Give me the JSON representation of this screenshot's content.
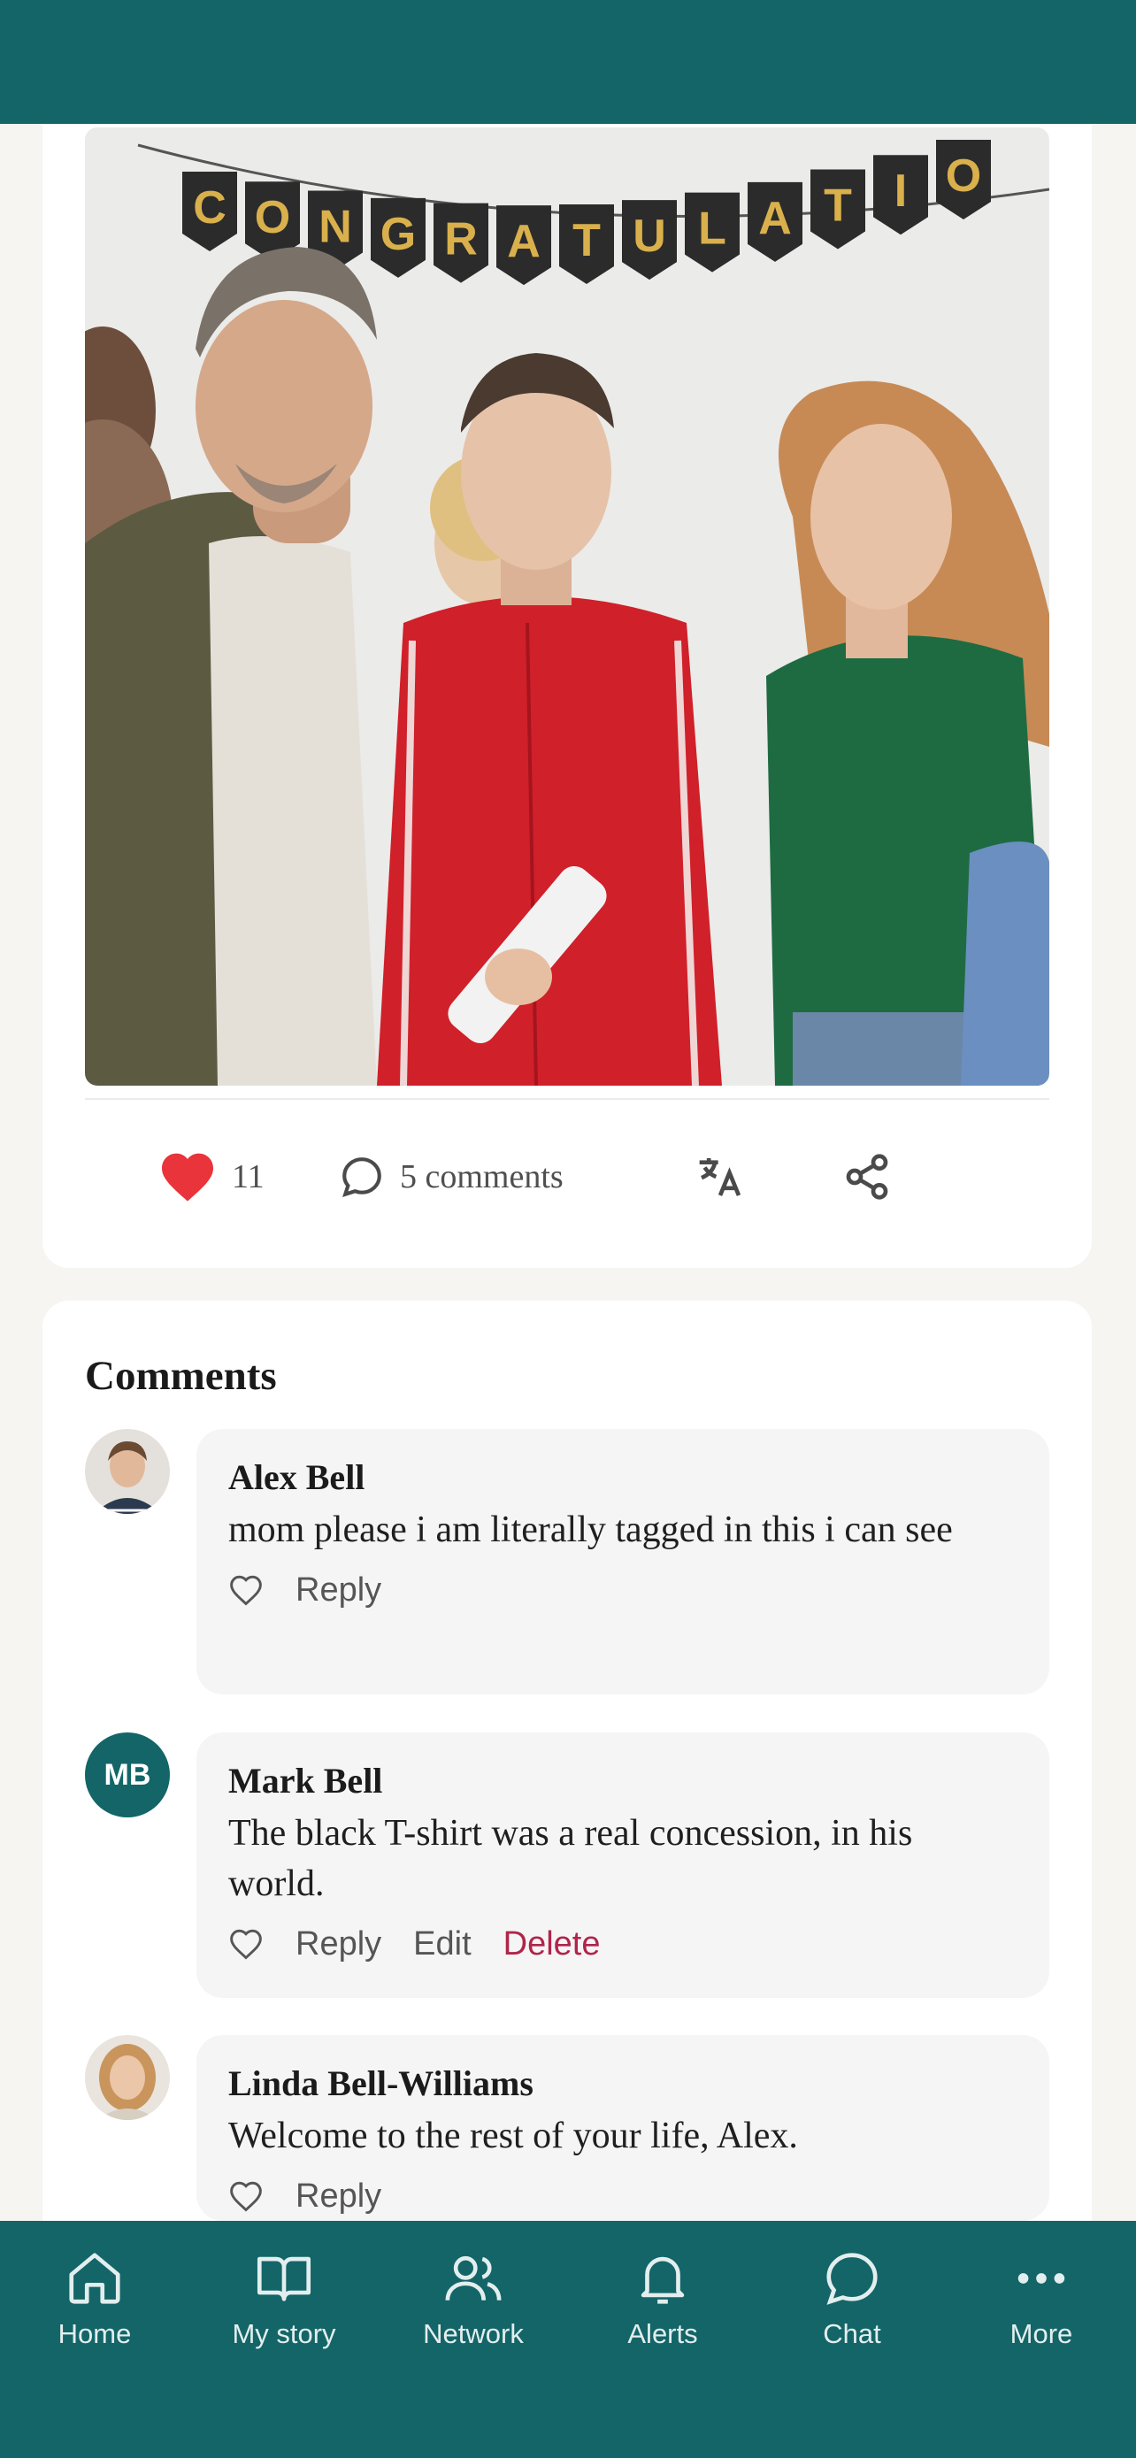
{
  "colors": {
    "header": "#136568",
    "like": "#e8343a",
    "delete": "#b0254a"
  },
  "post": {
    "photo_icon": "graduation-photo",
    "banner_letters": [
      "C",
      "O",
      "N",
      "G",
      "R",
      "A",
      "T",
      "U",
      "L",
      "A",
      "T",
      "I",
      "O"
    ],
    "likes_count": "11",
    "comments_label": "5 comments",
    "icons": {
      "like": "heart-filled-icon",
      "comment": "speech-bubble-icon",
      "translate": "translate-icon",
      "share": "share-icon"
    }
  },
  "comments": {
    "title": "Comments",
    "items": [
      {
        "author": "Alex Bell",
        "text": "mom please i am literally tagged in this i can see",
        "reply_label": "Reply",
        "avatar": "photo"
      },
      {
        "author": "Mark Bell",
        "text": "The black T-shirt was a real concession, in his world.",
        "reply_label": "Reply",
        "edit_label": "Edit",
        "delete_label": "Delete",
        "avatar_initials": "MB"
      },
      {
        "author": "Linda Bell-Williams",
        "text": "Welcome to the rest of your life, Alex.",
        "reply_label": "Reply",
        "avatar": "photo"
      }
    ]
  },
  "nav": {
    "items": [
      {
        "label": "Home",
        "icon": "home-icon"
      },
      {
        "label": "My story",
        "icon": "book-icon"
      },
      {
        "label": "Network",
        "icon": "people-icon"
      },
      {
        "label": "Alerts",
        "icon": "bell-icon"
      },
      {
        "label": "Chat",
        "icon": "chat-icon"
      },
      {
        "label": "More",
        "icon": "more-icon"
      }
    ]
  }
}
